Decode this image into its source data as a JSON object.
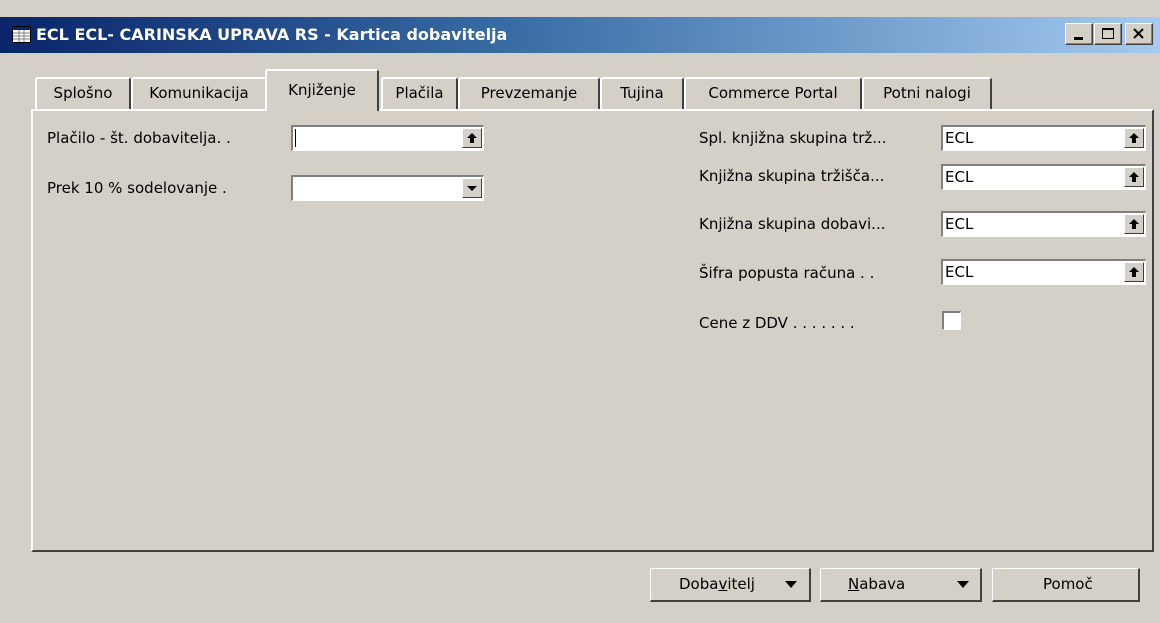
{
  "window": {
    "title": "ECL ECL- CARINSKA UPRAVA RS - Kartica dobavitelja",
    "controls": [
      "minimize-icon",
      "maximize-icon",
      "close-icon"
    ],
    "title_color": "#0a246a"
  },
  "tabs": [
    {
      "label": "Splošno",
      "active": false
    },
    {
      "label": "Komunikacija",
      "active": false
    },
    {
      "label": "Knjiženje",
      "active": true
    },
    {
      "label": "Plačila",
      "active": false
    },
    {
      "label": "Prevzemanje",
      "active": false
    },
    {
      "label": "Tujina",
      "active": false
    },
    {
      "label": "Commerce Portal",
      "active": false
    },
    {
      "label": "Potni nalogi",
      "active": false
    }
  ],
  "left_fields": [
    {
      "label": "Plačilo - št. dobavitelja. .",
      "value": "",
      "button": "lookup-arrow-icon"
    },
    {
      "label": "Prek 10 % sodelovanje  .",
      "value": "",
      "button": "dropdown-icon"
    }
  ],
  "right_fields": [
    {
      "label": "Spl. knjižna skupina trž...",
      "value": "ECL",
      "button": "lookup-arrow-icon"
    },
    {
      "label": "Knjižna skupina tržišča...",
      "value": "ECL",
      "button": "lookup-arrow-icon"
    },
    {
      "label": "Knjižna skupina dobavi...",
      "value": "ECL",
      "button": "lookup-arrow-icon"
    },
    {
      "label": "Šifra popusta računa  . .",
      "value": "ECL",
      "button": "lookup-arrow-icon"
    }
  ],
  "checkbox_field": {
    "label": "Cene z DDV . . . . . . .",
    "checked": false
  },
  "buttons": {
    "dobavitelj": {
      "pre": "Doba",
      "accel": "v",
      "post": "itelj"
    },
    "nabava": {
      "pre": "",
      "accel": "N",
      "post": "abava"
    },
    "pomoc": "Pomoč"
  }
}
